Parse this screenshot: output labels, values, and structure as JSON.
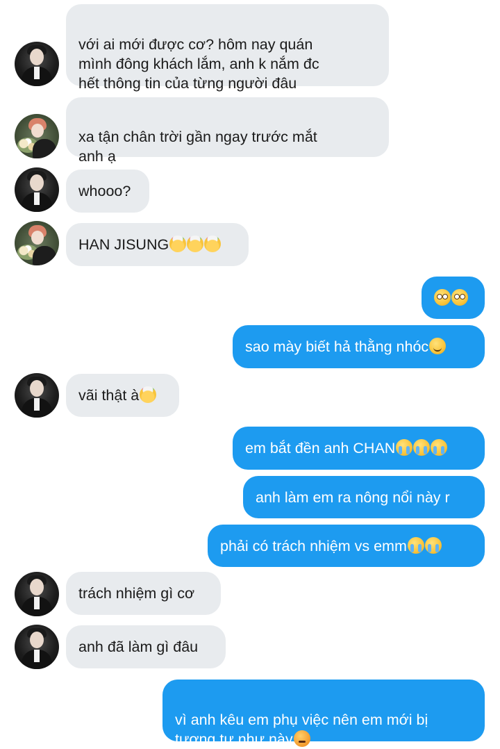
{
  "conversation": {
    "messages": [
      {
        "sender": "friend_dark",
        "text": "với ai mới được cơ? hôm nay quán\nmình đông khách lắm, anh k nắm đc\nhết thông tin của từng người đâu"
      },
      {
        "sender": "friend_light",
        "text": "xa tận chân trời gần ngay trước mắt\nanh ạ"
      },
      {
        "sender": "friend_dark",
        "text": "whooo?"
      },
      {
        "sender": "friend_light",
        "text": "HAN JISUNG",
        "emojis": [
          "exploding-head",
          "exploding-head",
          "exploding-head"
        ]
      },
      {
        "sender": "me",
        "text": "",
        "emojis": [
          "flushed-face",
          "flushed-face"
        ]
      },
      {
        "sender": "me",
        "text": "sao mày biết hả thằng nhóc",
        "emojis": [
          "slightly-smiling-face"
        ]
      },
      {
        "sender": "friend_dark",
        "text": "vãi thật à",
        "emojis": [
          "exploding-head"
        ]
      },
      {
        "sender": "me",
        "text": "em bắt đền anh CHAN",
        "emojis": [
          "loudly-crying-face",
          "loudly-crying-face",
          "loudly-crying-face"
        ]
      },
      {
        "sender": "me",
        "text": "anh làm em ra nông nổi này r"
      },
      {
        "sender": "me",
        "text": "phải có trách nhiệm vs emm",
        "emojis": [
          "loudly-crying-face",
          "loudly-crying-face"
        ]
      },
      {
        "sender": "friend_dark",
        "text": "trách nhiệm gì cơ"
      },
      {
        "sender": "friend_dark",
        "text": "anh đã làm gì đâu"
      },
      {
        "sender": "me",
        "text": "vì anh kêu em phụ việc nên em mới bị\ntương tư như này",
        "emojis": [
          "pouting-face"
        ]
      }
    ]
  },
  "colors": {
    "incoming_bubble": "#e8ebee",
    "outgoing_bubble": "#1d9bf0",
    "incoming_text": "#1a1a1a",
    "outgoing_text": "#ffffff",
    "background": "#ffffff"
  }
}
